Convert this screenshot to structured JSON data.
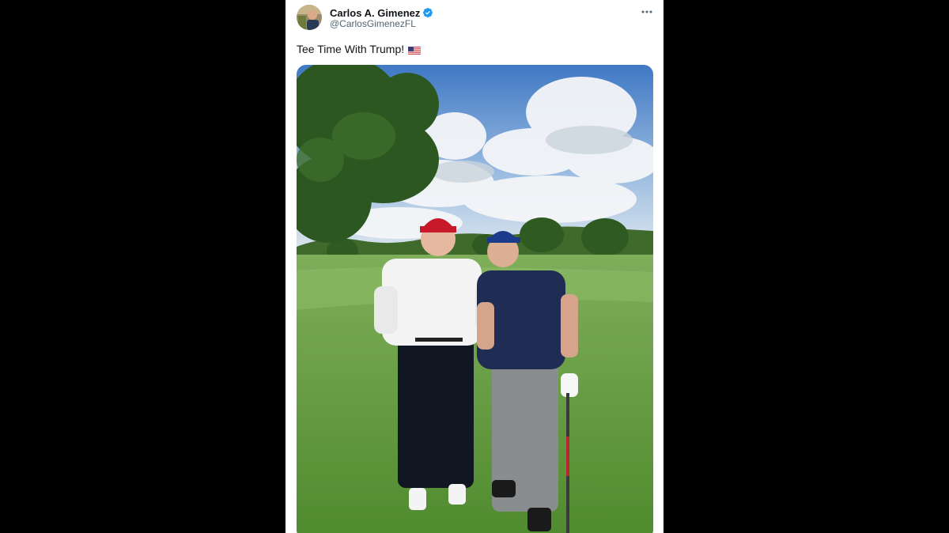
{
  "tweet": {
    "author": {
      "display_name": "Carlos A. Gimenez",
      "handle": "@CarlosGimenezFL",
      "verified": true,
      "avatar_icon": "profile-photo"
    },
    "text": "Tee Time With Trump!",
    "emoji_icon": "us-flag-emoji",
    "more_icon": "more-dots-icon",
    "media_icon": "golf-course-photo"
  },
  "colors": {
    "background": "#000000",
    "card": "#ffffff",
    "text_primary": "#0f1419",
    "text_secondary": "#536471",
    "verified_blue": "#1d9bf0"
  }
}
